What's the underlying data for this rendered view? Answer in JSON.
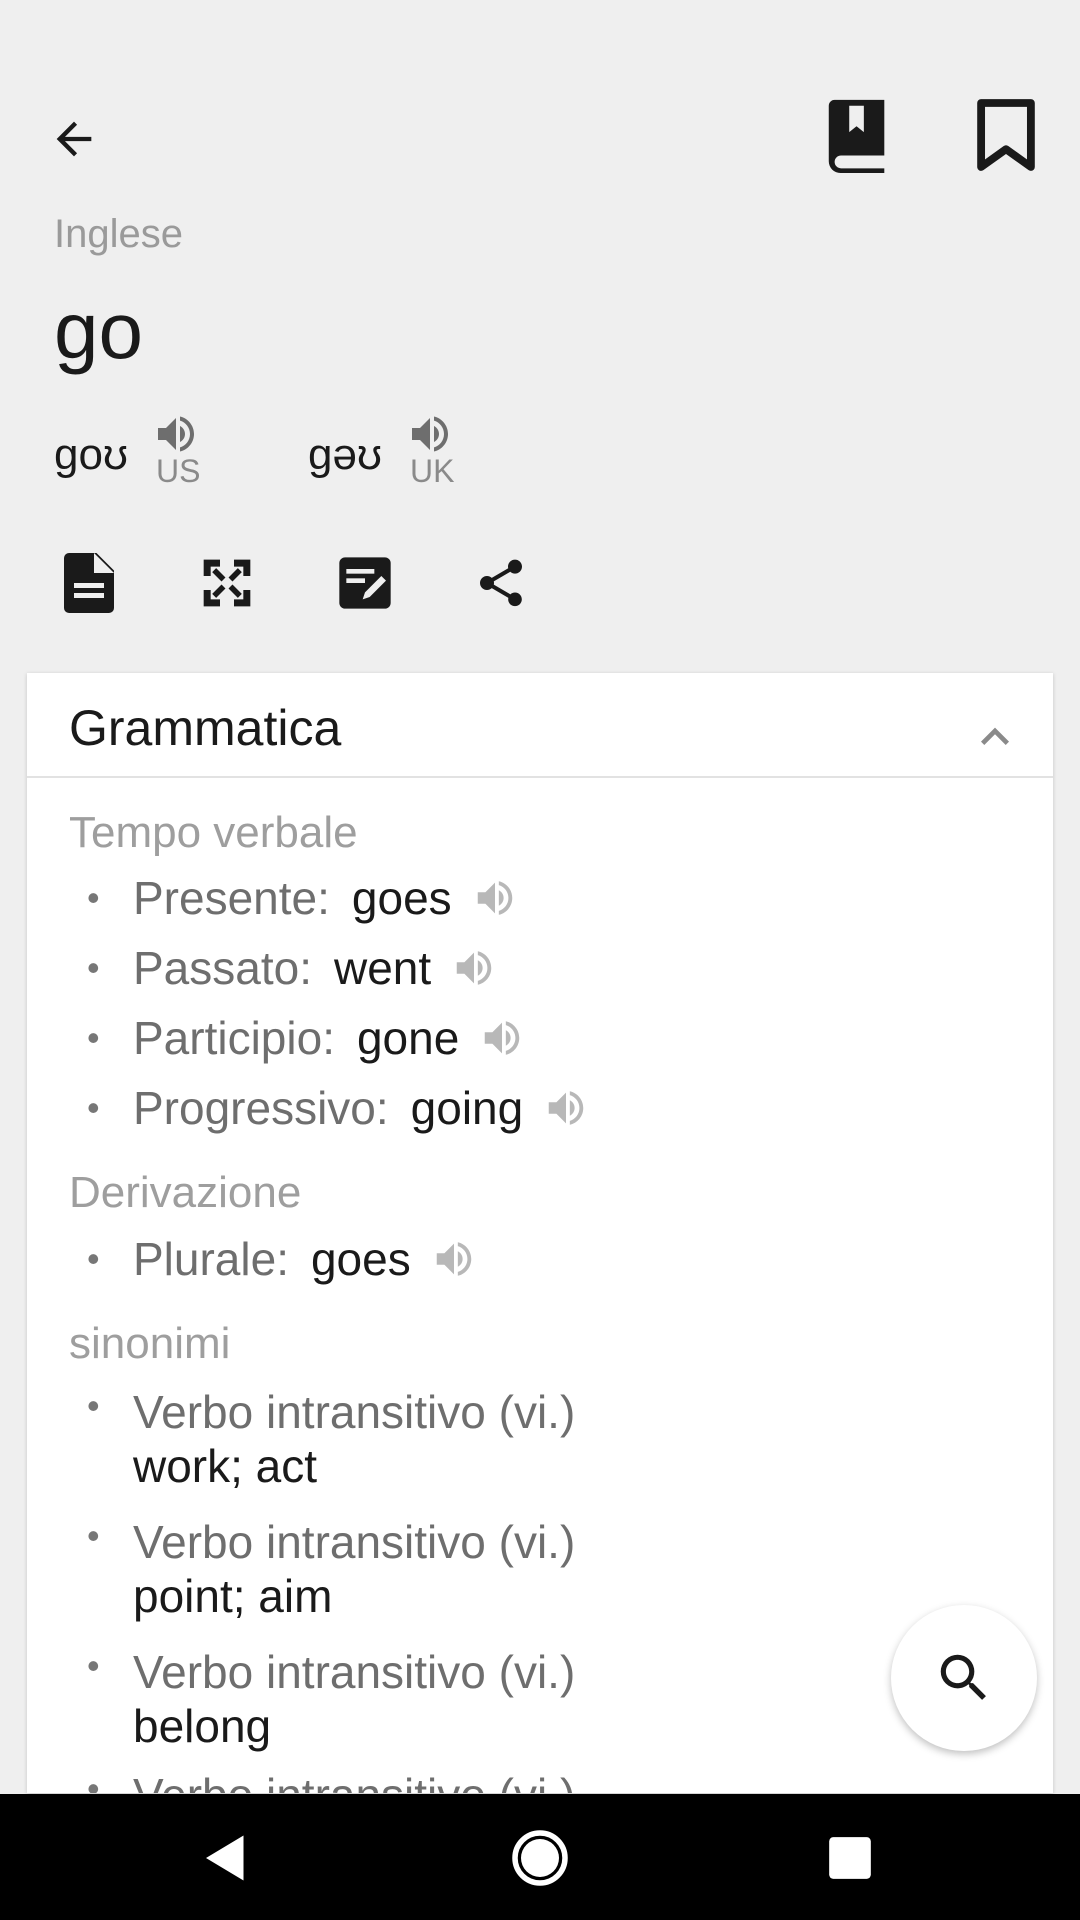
{
  "header": {
    "language": "Inglese",
    "word": "go",
    "pronunciations": [
      {
        "ipa": "goʊ",
        "region": "US"
      },
      {
        "ipa": "gəʊ",
        "region": "UK"
      }
    ],
    "icons": {
      "back": "back-arrow-icon",
      "dictionary": "dictionary-book-icon",
      "bookmark": "bookmark-icon",
      "document": "document-icon",
      "fullscreen": "fullscreen-icon",
      "edit": "edit-note-icon",
      "share": "share-icon"
    }
  },
  "card": {
    "title": "Grammatica",
    "tense": {
      "title": "Tempo verbale",
      "items": [
        {
          "label": "Presente:",
          "value": "goes"
        },
        {
          "label": "Passato:",
          "value": "went"
        },
        {
          "label": "Participio:",
          "value": "gone"
        },
        {
          "label": "Progressivo:",
          "value": "going"
        }
      ]
    },
    "derivation": {
      "title": "Derivazione",
      "items": [
        {
          "label": "Plurale:",
          "value": "goes"
        }
      ]
    },
    "synonyms": {
      "title": "sinonimi",
      "items": [
        {
          "label": "Verbo intransitivo (vi.)",
          "value": "work; act"
        },
        {
          "label": "Verbo intransitivo (vi.)",
          "value": "point; aim"
        },
        {
          "label": "Verbo intransitivo (vi.)",
          "value": "belong"
        },
        {
          "label": "Verbo intransitivo (vi.)",
          "value": ""
        }
      ]
    }
  },
  "fab": {
    "icon": "search-icon"
  },
  "bullet": "•",
  "colors": {
    "background": "#efefef",
    "card": "#ffffff",
    "muted": "#9e9e9e",
    "navbar": "#000000"
  }
}
